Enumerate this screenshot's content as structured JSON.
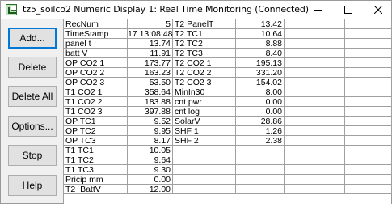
{
  "window": {
    "title": "tz5_soilco2 Numeric Display 1: Real Time Monitoring (Connected)"
  },
  "titlebar_buttons": {
    "minimize_icon": "minimize-icon",
    "maximize_icon": "maximize-icon",
    "close_icon": "close-icon"
  },
  "sidebar": {
    "add": "Add...",
    "delete": "Delete",
    "delete_all": "Delete All",
    "options": "Options...",
    "stop": "Stop",
    "help": "Help"
  },
  "table": {
    "col1": [
      {
        "name": "RecNum",
        "value": "5"
      },
      {
        "name": "TimeStamp",
        "value": "17 13:08:48"
      },
      {
        "name": "panel  t",
        "value": "13.74"
      },
      {
        "name": "batt  V",
        "value": "11.91"
      },
      {
        "name": "OP  CO2  1",
        "value": "173.77"
      },
      {
        "name": "OP  CO2  2",
        "value": "163.23"
      },
      {
        "name": "OP  CO2  3",
        "value": "53.50"
      },
      {
        "name": "T1  CO2  1",
        "value": "358.64"
      },
      {
        "name": "T1  CO2  2",
        "value": "183.88"
      },
      {
        "name": "T1  CO2  3",
        "value": "397.88"
      },
      {
        "name": "OP  TC1",
        "value": "9.52"
      },
      {
        "name": "OP  TC2",
        "value": "9.95"
      },
      {
        "name": "OP  TC3",
        "value": "8.17"
      },
      {
        "name": "T1  TC1",
        "value": "10.05"
      },
      {
        "name": "T1  TC2",
        "value": "9.64"
      },
      {
        "name": "T1  TC3",
        "value": "9.30"
      },
      {
        "name": "Pricip  mm",
        "value": "0.00"
      },
      {
        "name": "T2_BattV",
        "value": "12.00"
      }
    ],
    "col2": [
      {
        "name": "T2  PanelT",
        "value": "13.42"
      },
      {
        "name": "T2  TC1",
        "value": "10.64"
      },
      {
        "name": "T2  TC2",
        "value": "8.88"
      },
      {
        "name": "T2  TC3",
        "value": "8.40"
      },
      {
        "name": "T2  CO2  1",
        "value": "195.13"
      },
      {
        "name": "T2  CO2  2",
        "value": "331.20"
      },
      {
        "name": "T2  CO2  3",
        "value": "154.02"
      },
      {
        "name": "MinIn30",
        "value": "8.00"
      },
      {
        "name": "cnt  pwr",
        "value": "0.00"
      },
      {
        "name": "cnt  log",
        "value": "0.00"
      },
      {
        "name": "SolarV",
        "value": "28.86"
      },
      {
        "name": "SHF  1",
        "value": "1.26"
      },
      {
        "name": "SHF  2",
        "value": "2.38"
      },
      {
        "name": "",
        "value": ""
      },
      {
        "name": "",
        "value": ""
      },
      {
        "name": "",
        "value": ""
      },
      {
        "name": "",
        "value": ""
      },
      {
        "name": "",
        "value": ""
      }
    ],
    "col3": [
      {
        "name": "",
        "value": ""
      },
      {
        "name": "",
        "value": ""
      },
      {
        "name": "",
        "value": ""
      },
      {
        "name": "",
        "value": ""
      },
      {
        "name": "",
        "value": ""
      },
      {
        "name": "",
        "value": ""
      },
      {
        "name": "",
        "value": ""
      },
      {
        "name": "",
        "value": ""
      },
      {
        "name": "",
        "value": ""
      },
      {
        "name": "",
        "value": ""
      },
      {
        "name": "",
        "value": ""
      },
      {
        "name": "",
        "value": ""
      },
      {
        "name": "",
        "value": ""
      },
      {
        "name": "",
        "value": ""
      },
      {
        "name": "",
        "value": ""
      },
      {
        "name": "",
        "value": ""
      },
      {
        "name": "",
        "value": ""
      },
      {
        "name": "",
        "value": ""
      }
    ]
  }
}
